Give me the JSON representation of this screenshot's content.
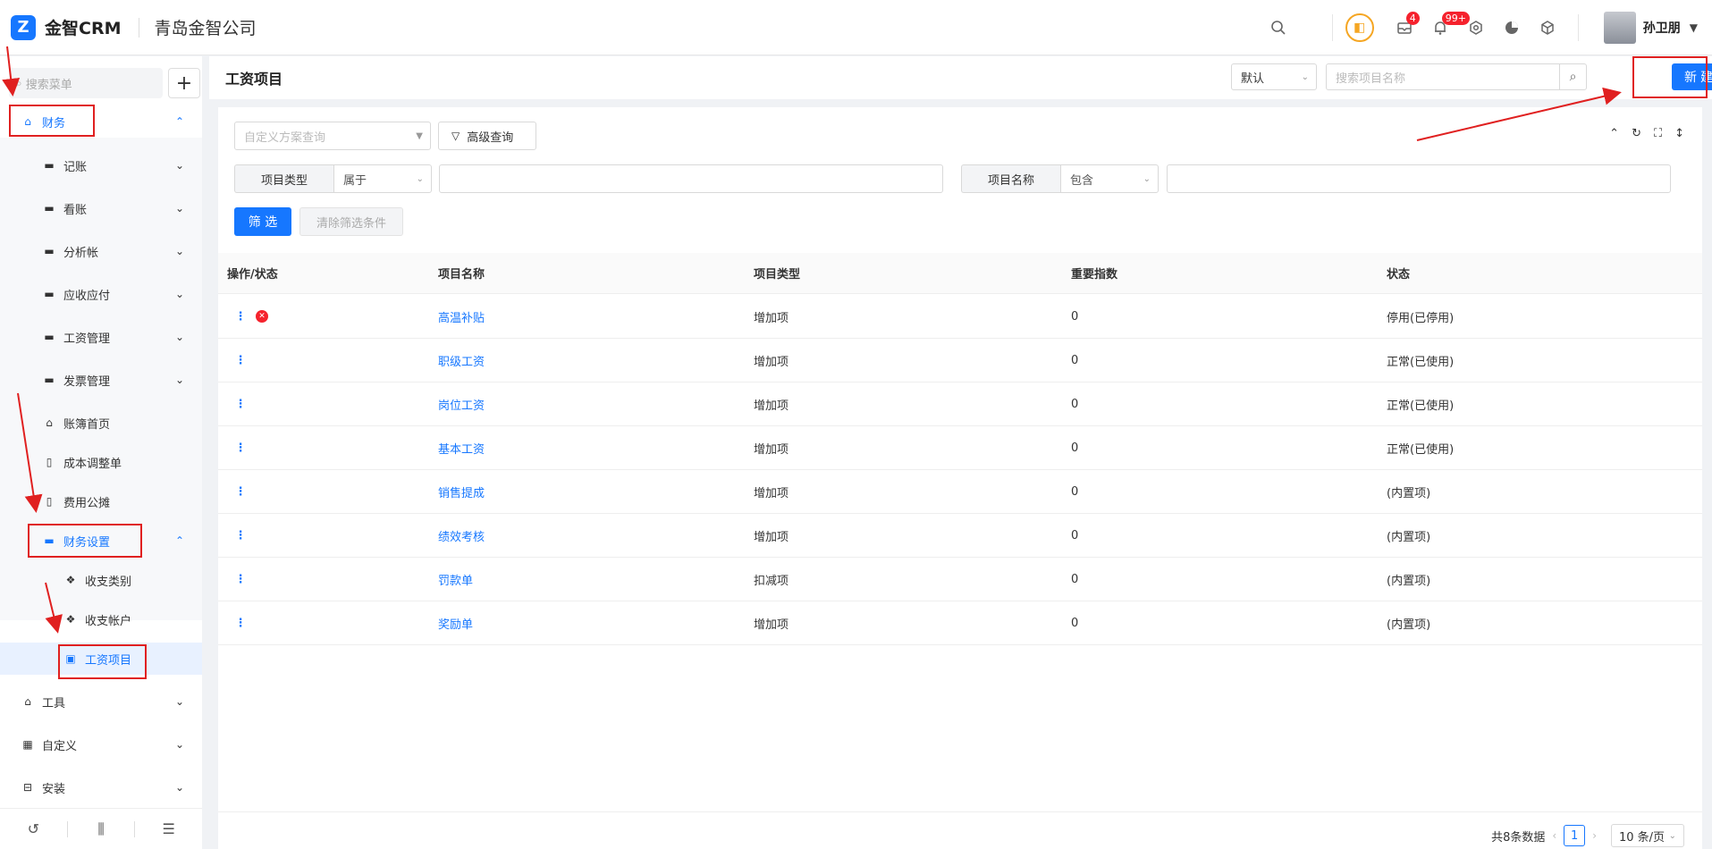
{
  "topbar": {
    "logo_mark": "Z",
    "logo_text": "金智CRM",
    "company": "青岛金智公司",
    "badge_messages": "4",
    "badge_notifications": "99+",
    "user_name": "孙卫朋",
    "icons": [
      "search-icon",
      "plugin-icon",
      "message-icon",
      "bell-icon",
      "settings-icon",
      "pie-chart-icon",
      "cube-icon"
    ]
  },
  "sidebar": {
    "search_placeholder": "搜索菜单",
    "add_label": "+",
    "items": [
      {
        "label": "财务",
        "icon": "home-icon"
      },
      {
        "label": "记账",
        "icon": "folder-icon"
      },
      {
        "label": "看账",
        "icon": "folder-icon"
      },
      {
        "label": "分析帐",
        "icon": "folder-icon"
      },
      {
        "label": "应收应付",
        "icon": "folder-icon"
      },
      {
        "label": "工资管理",
        "icon": "folder-icon"
      },
      {
        "label": "发票管理",
        "icon": "folder-icon"
      },
      {
        "label": "账簿首页",
        "icon": "home-icon"
      },
      {
        "label": "成本调整单",
        "icon": "document-icon"
      },
      {
        "label": "费用公摊",
        "icon": "document-icon"
      },
      {
        "label": "财务设置",
        "icon": "folder-icon"
      },
      {
        "label": "收支类别",
        "icon": "diamond-icon"
      },
      {
        "label": "收支帐户",
        "icon": "diamond-icon"
      },
      {
        "label": "工资项目",
        "icon": "salary-icon"
      },
      {
        "label": "工具",
        "icon": "toolbox-icon"
      },
      {
        "label": "自定义",
        "icon": "grid-icon"
      },
      {
        "label": "安装",
        "icon": "install-icon"
      }
    ]
  },
  "header": {
    "title": "工资项目",
    "view_select": "默认",
    "search_placeholder": "搜索项目名称",
    "new_button": "新建"
  },
  "filters": {
    "scheme_placeholder": "自定义方案查询",
    "advanced_query": "高级查询",
    "type_label": "项目类型",
    "type_operator": "属于",
    "name_label": "项目名称",
    "name_operator": "包含",
    "filter_button": "筛 选",
    "clear_button": "清除筛选条件"
  },
  "table": {
    "columns": [
      "操作/状态",
      "项目名称",
      "项目类型",
      "重要指数",
      "状态"
    ],
    "rows": [
      {
        "name": "高温补贴",
        "type": "增加项",
        "importance": "0",
        "status": "停用(已停用)",
        "disabled": true
      },
      {
        "name": "职级工资",
        "type": "增加项",
        "importance": "0",
        "status": "正常(已使用)",
        "disabled": false
      },
      {
        "name": "岗位工资",
        "type": "增加项",
        "importance": "0",
        "status": "正常(已使用)",
        "disabled": false
      },
      {
        "name": "基本工资",
        "type": "增加项",
        "importance": "0",
        "status": "正常(已使用)",
        "disabled": false
      },
      {
        "name": "销售提成",
        "type": "增加项",
        "importance": "0",
        "status": "(内置项)",
        "disabled": false
      },
      {
        "name": "绩效考核",
        "type": "增加项",
        "importance": "0",
        "status": "(内置项)",
        "disabled": false
      },
      {
        "name": "罚款单",
        "type": "扣减项",
        "importance": "0",
        "status": "(内置项)",
        "disabled": false
      },
      {
        "name": "奖励单",
        "type": "增加项",
        "importance": "0",
        "status": "(内置项)",
        "disabled": false
      }
    ]
  },
  "pagination": {
    "total_text": "共8条数据",
    "current_page": "1",
    "page_size": "10 条/页"
  },
  "colors": {
    "primary": "#1677ff",
    "danger": "#f5222d",
    "annotation": "#e02020"
  }
}
